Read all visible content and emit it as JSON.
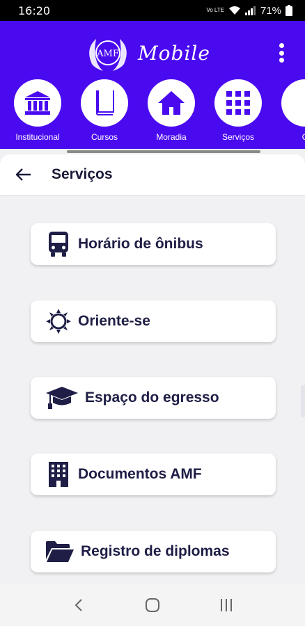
{
  "status": {
    "time": "16:20",
    "battery": "71%",
    "network": "Vo LTE"
  },
  "app": {
    "logo_badge": "AMF",
    "logo_text": "Mobile"
  },
  "nav": [
    {
      "label": "Institucional",
      "icon": "bank-icon"
    },
    {
      "label": "Cursos",
      "icon": "book-icon"
    },
    {
      "label": "Moradia",
      "icon": "home-icon"
    },
    {
      "label": "Serviços",
      "icon": "grid-icon"
    },
    {
      "label": "C",
      "icon": "partial-icon"
    }
  ],
  "page": {
    "title": "Serviços"
  },
  "services": [
    {
      "label": "Horário de ônibus",
      "icon": "bus-icon"
    },
    {
      "label": "Oriente-se",
      "icon": "sun-icon"
    },
    {
      "label": "Espaço do egresso",
      "icon": "graduation-cap-icon"
    },
    {
      "label": "Documentos AMF",
      "icon": "building-icon"
    },
    {
      "label": "Registro de diplomas",
      "icon": "folder-icon"
    }
  ],
  "colors": {
    "primary": "#4a0af0",
    "text_dark": "#1e1e46"
  }
}
